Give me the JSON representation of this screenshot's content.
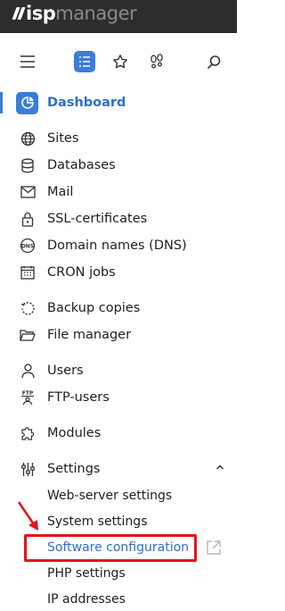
{
  "header": {
    "logo_isp": "isp",
    "logo_manager": "manager"
  },
  "toolbar": {
    "icons": [
      "menu-icon",
      "list-icon",
      "star-icon",
      "footprints-icon",
      "search-icon"
    ],
    "accent_color": "#3b7dd8"
  },
  "sidebar": {
    "dashboard": "Dashboard",
    "items": [
      {
        "label": "Sites",
        "icon": "globe-icon"
      },
      {
        "label": "Databases",
        "icon": "database-icon"
      },
      {
        "label": "Mail",
        "icon": "mail-icon"
      },
      {
        "label": "SSL-certificates",
        "icon": "lock-icon"
      },
      {
        "label": "Domain names (DNS)",
        "icon": "dns-icon"
      },
      {
        "label": "CRON jobs",
        "icon": "calendar-icon"
      },
      {
        "label": "Backup copies",
        "icon": "backup-icon"
      },
      {
        "label": "File manager",
        "icon": "folder-icon"
      },
      {
        "label": "Users",
        "icon": "user-icon"
      },
      {
        "label": "FTP-users",
        "icon": "ftp-user-icon"
      },
      {
        "label": "Modules",
        "icon": "puzzle-icon"
      },
      {
        "label": "Settings",
        "icon": "sliders-icon"
      }
    ],
    "settings_sub": [
      {
        "label": "Web-server settings"
      },
      {
        "label": "System settings"
      },
      {
        "label": "Software configuration"
      },
      {
        "label": "PHP settings"
      },
      {
        "label": "IP addresses"
      }
    ],
    "highlight_color": "#e3141c"
  }
}
